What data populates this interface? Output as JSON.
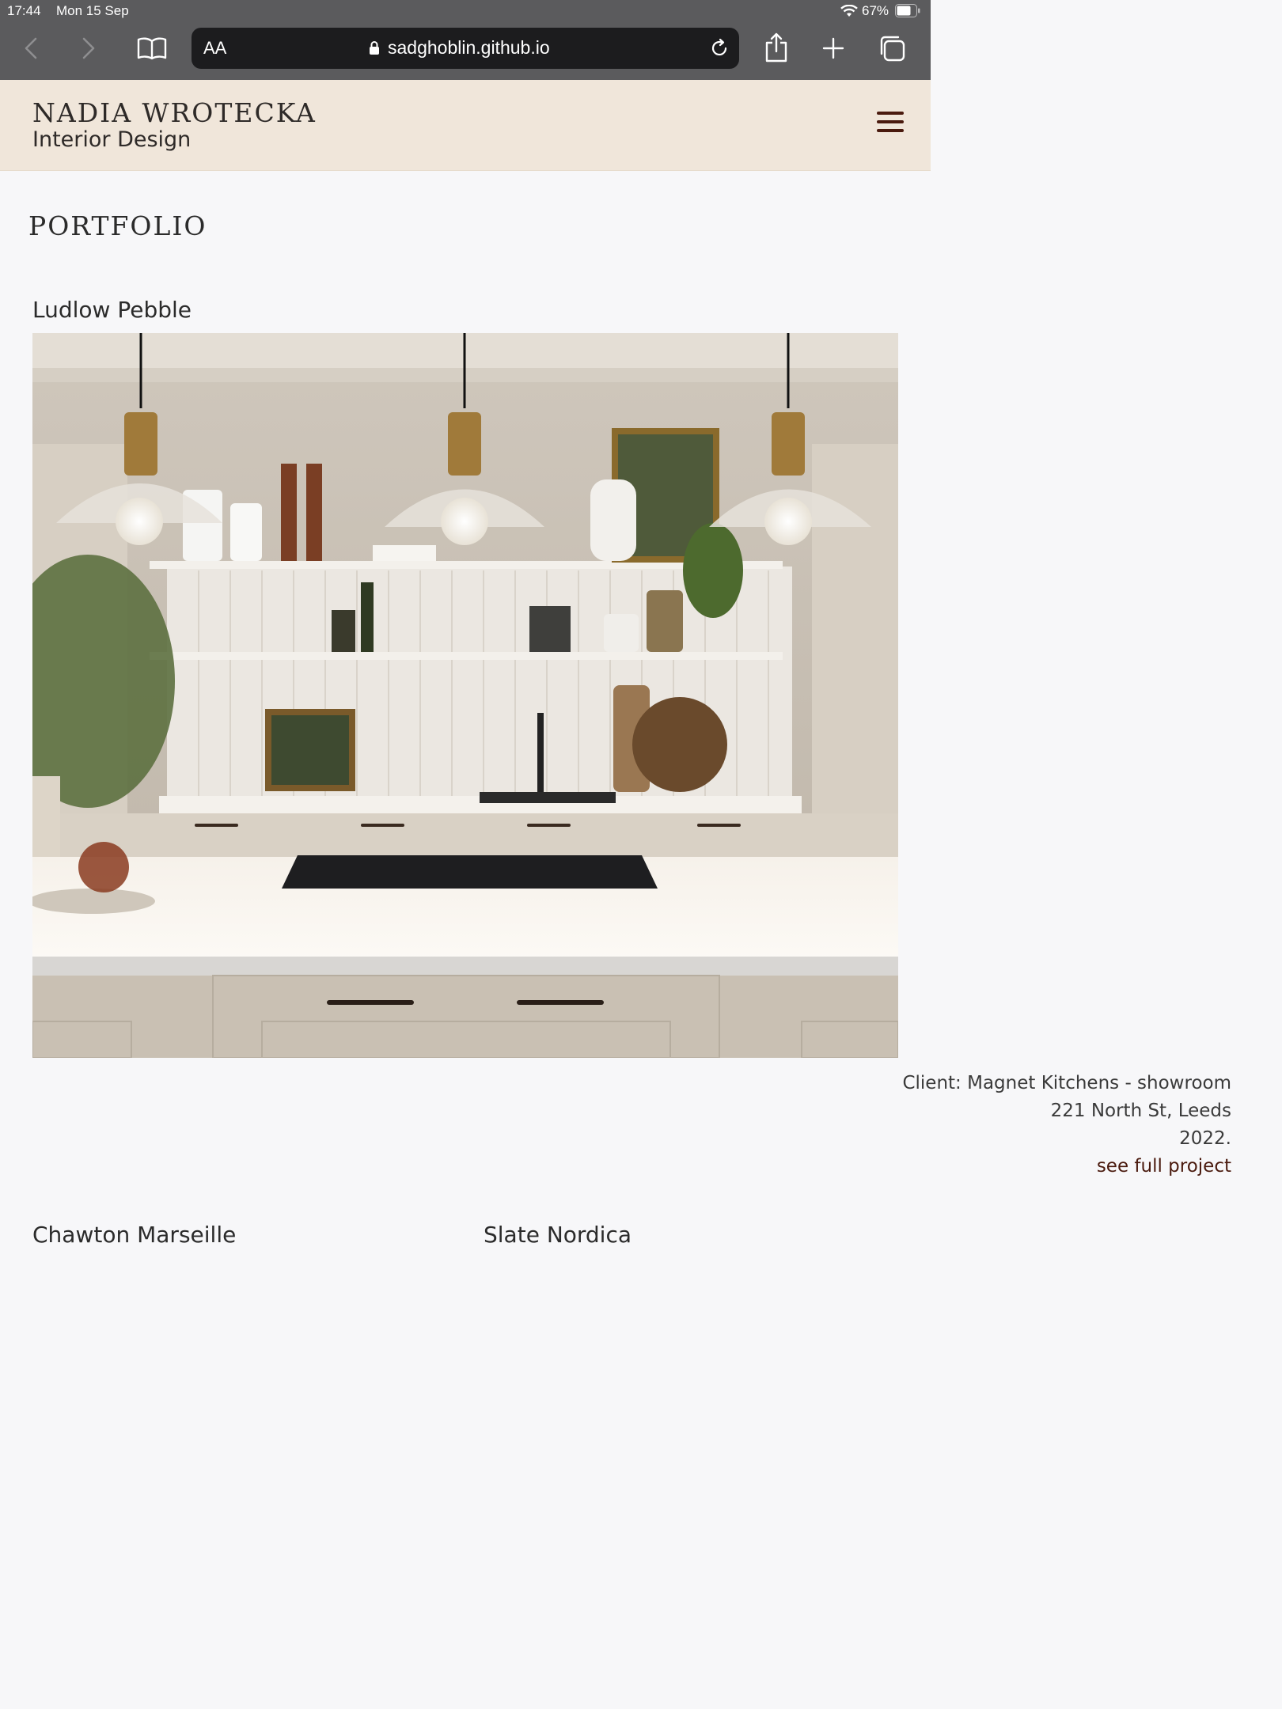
{
  "status_bar": {
    "time": "17:44",
    "date": "Mon 15 Sep",
    "battery_percent": "67%"
  },
  "browser": {
    "text_size_label": "AA",
    "url": "sadghoblin.github.io"
  },
  "site": {
    "brand_name": "NADIA WROTECKA",
    "brand_subtitle": "Interior Design",
    "accent_color": "#4a1a0e"
  },
  "page": {
    "title": "PORTFOLIO"
  },
  "projects": [
    {
      "title": "Ludlow Pebble",
      "client": "Client: Magnet Kitchens - showroom",
      "address": "221 North St, Leeds",
      "year": "2022.",
      "link_label": "see full project"
    },
    {
      "title": "Chawton Marseille"
    },
    {
      "title": "Slate Nordica"
    }
  ]
}
